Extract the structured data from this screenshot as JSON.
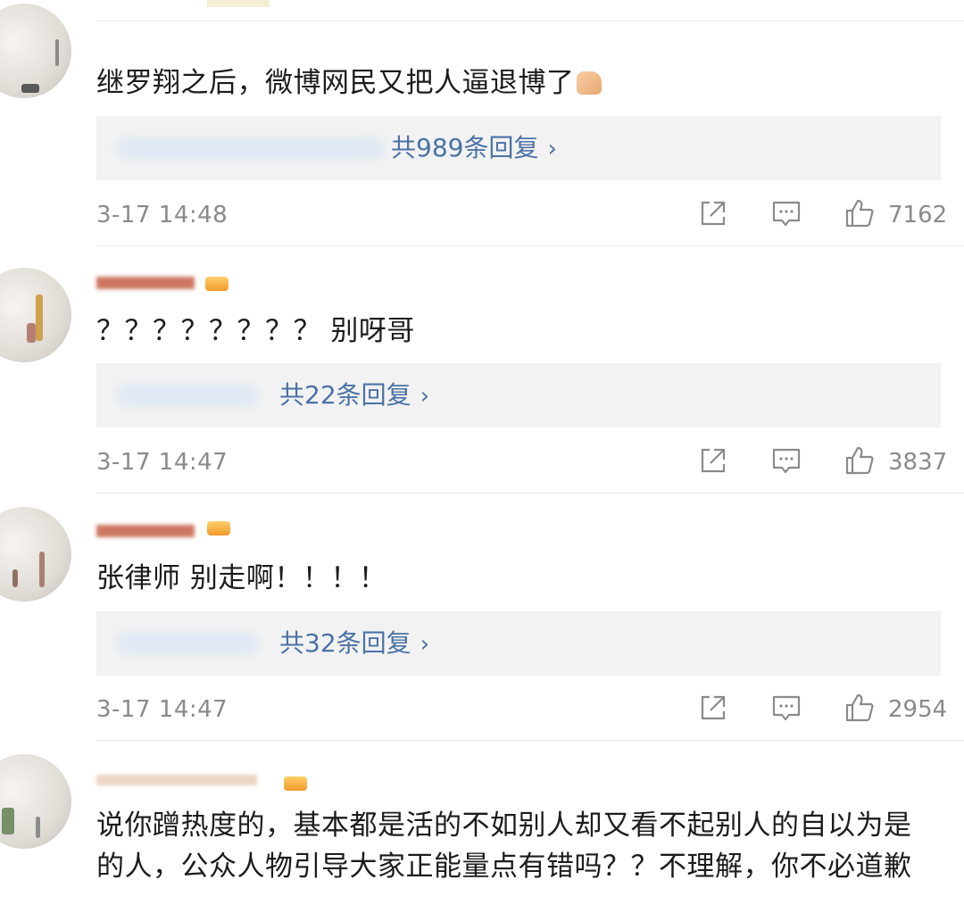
{
  "comments": [
    {
      "text": "继罗翔之后，微博网民又把人逼退博了",
      "emoji": "thumbs-up-emoji",
      "reply_count": "共989条回复",
      "time": "3-17 14:48",
      "likes": "7162"
    },
    {
      "text": "？？？？？？？？ 别呀哥",
      "reply_count": "共22条回复",
      "time": "3-17 14:47",
      "likes": "3837"
    },
    {
      "text": "张律师 别走啊！！！！",
      "reply_count": "共32条回复",
      "time": "3-17 14:47",
      "likes": "2954"
    },
    {
      "text": "说你蹭热度的，基本都是活的不如别人却又看不起别人的自以为是的人，公众人物引导大家正能量点有错吗？？不理解，你不必道歉"
    }
  ],
  "icons": {
    "share": "share-icon",
    "comment": "comment-icon",
    "like": "like-icon",
    "reply_chevron": "chevron-right-icon"
  },
  "colors": {
    "reply_link": "#4a72a6",
    "meta_gray": "#8a8a8a",
    "reply_bg": "#f2f2f2",
    "username_orange": "#d06c32"
  }
}
